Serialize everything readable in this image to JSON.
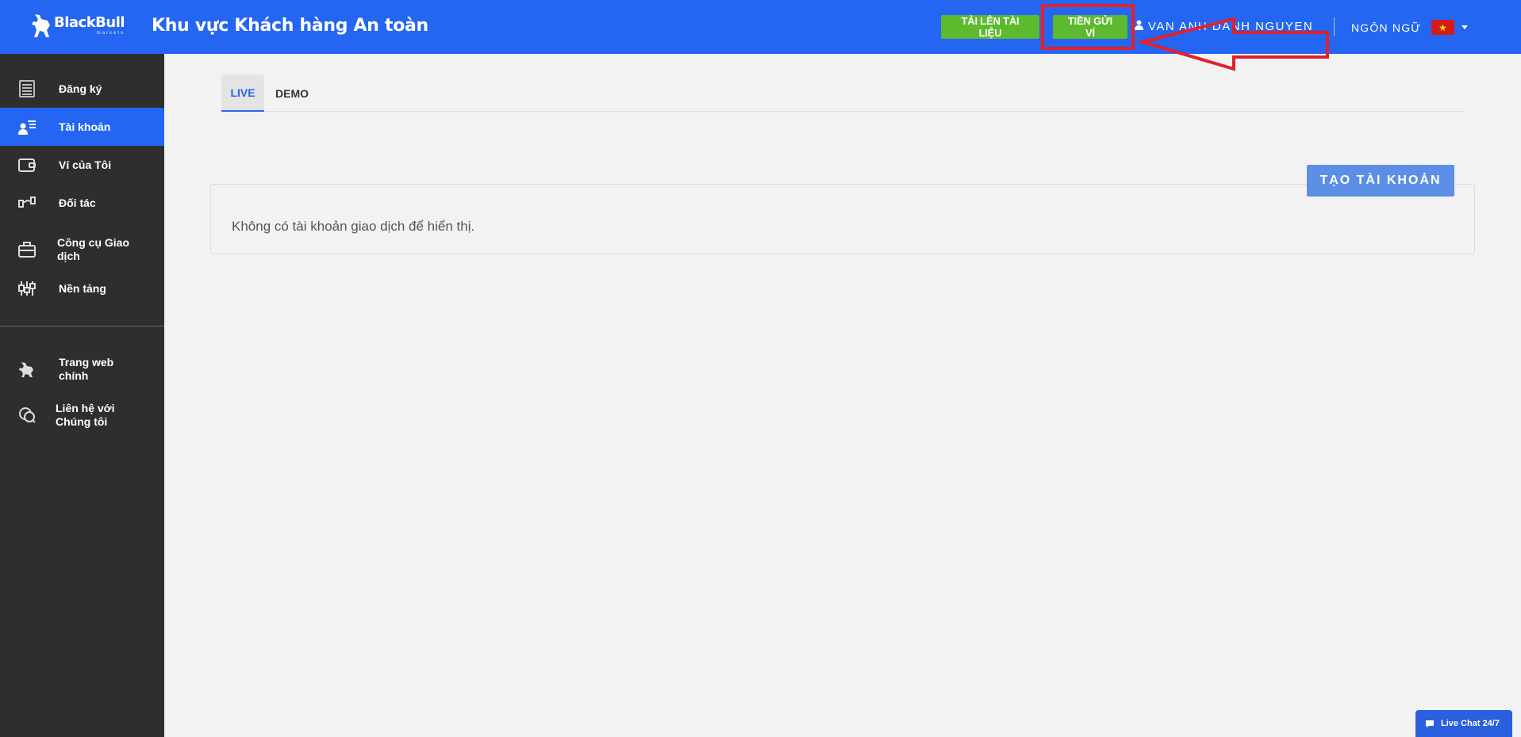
{
  "header": {
    "logo": {
      "name": "BlackBull",
      "sub": "markets"
    },
    "title": "Khu vực Khách hàng An toàn",
    "upload_button": "TẢI LÊN TÀI LIỆU",
    "deposit_button": "TIỀN GỬI VÍ",
    "user_name": "VAN ANH DANH NGUYEN",
    "language_label": "NGÔN NGỮ",
    "flag_star": "★"
  },
  "sidebar": {
    "items": [
      {
        "label": "Đăng ký",
        "icon": "register-icon",
        "active": false
      },
      {
        "label": "Tài khoản",
        "icon": "account-icon",
        "active": true
      },
      {
        "label": "Ví của Tôi",
        "icon": "wallet-icon",
        "active": false
      },
      {
        "label": "Đối tác",
        "icon": "partner-icon",
        "active": false
      },
      {
        "label": "Công cụ Giao dịch",
        "icon": "briefcase-icon",
        "active": false
      },
      {
        "label": "Nền tảng",
        "icon": "platform-icon",
        "active": false
      }
    ],
    "secondary": [
      {
        "label": "Trang web chính",
        "icon": "bull-icon"
      },
      {
        "label": "Liên hệ với Chúng tôi",
        "icon": "chat-bubbles-icon"
      }
    ]
  },
  "main": {
    "tabs": [
      {
        "label": "LIVE",
        "active": true
      },
      {
        "label": "DEMO",
        "active": false
      }
    ],
    "create_button": "TẠO TÀI KHOẢN",
    "empty_message": "Không có tài khoản giao dịch để hiển thị."
  },
  "live_chat": {
    "label": "Live Chat 24/7"
  },
  "colors": {
    "brand_blue": "#2466f2",
    "sidebar_bg": "#2e2e2e",
    "green_button": "#5dba2f",
    "annotation_red": "#e3202b"
  }
}
